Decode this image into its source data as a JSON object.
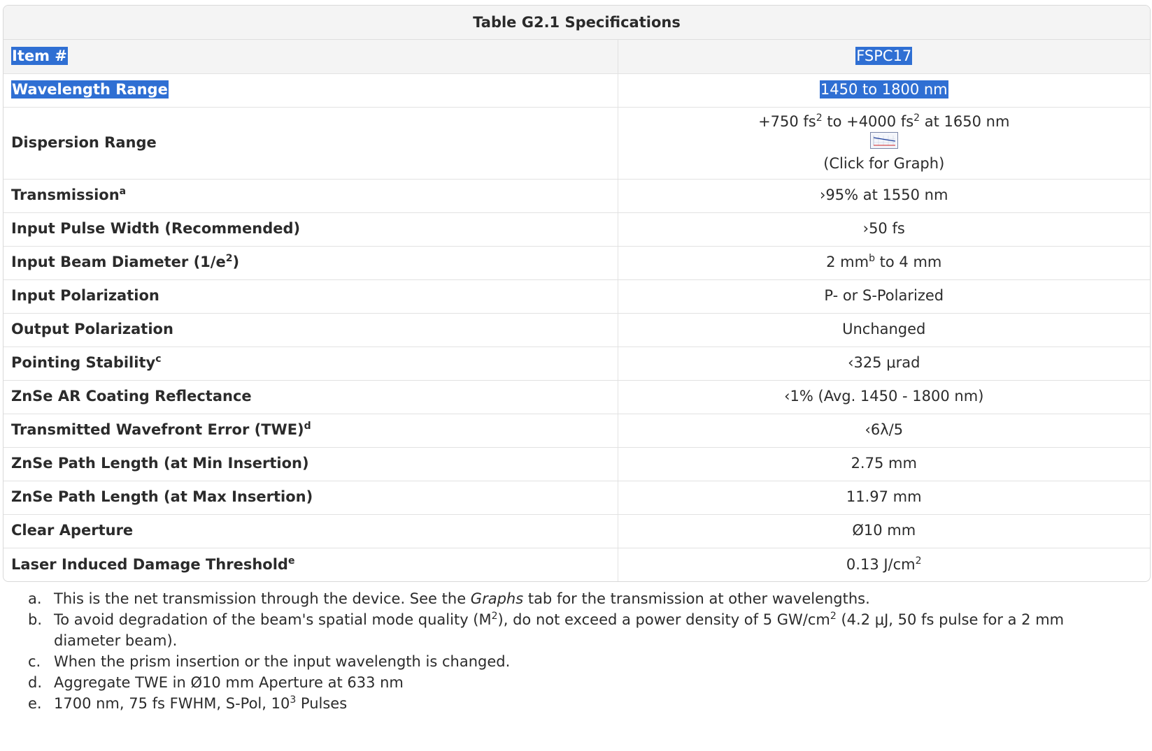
{
  "table": {
    "caption": "Table G2.1  Specifications",
    "header": {
      "label": "Item #",
      "value": "FSPC17"
    },
    "rows": [
      {
        "label": "Wavelength Range",
        "value": "1450 to 1800 nm"
      },
      {
        "label": "Dispersion Range",
        "value_a": "+750 fs",
        "value_a_sup": "2",
        "value_b": " to +4000 fs",
        "value_b_sup": "2",
        "value_c": " at 1650 nm",
        "link": "(Click for Graph)",
        "icon": "dispersion-graph-thumbnail"
      },
      {
        "label": "Transmission",
        "label_sup": "a",
        "value": "›95% at 1550 nm"
      },
      {
        "label": "Input Pulse Width (Recommended)",
        "value": "›50 fs"
      },
      {
        "label": "Input Beam Diameter (1/e",
        "label_sup": "2",
        "label_tail": ")",
        "value_a": "2 mm",
        "value_sup": "b",
        "value_b": " to 4 mm"
      },
      {
        "label": "Input Polarization",
        "value": "P- or S-Polarized"
      },
      {
        "label": "Output Polarization",
        "value": "Unchanged"
      },
      {
        "label": "Pointing Stability",
        "label_sup": "c",
        "value": "‹325 μrad"
      },
      {
        "label": "ZnSe AR Coating Reflectance",
        "value": "‹1% (Avg. 1450 - 1800 nm)"
      },
      {
        "label": "Transmitted Wavefront Error (TWE)",
        "label_sup": "d",
        "value": "‹6λ/5"
      },
      {
        "label": "ZnSe Path Length (at Min Insertion)",
        "value": "2.75 mm"
      },
      {
        "label": "ZnSe Path Length (at Max Insertion)",
        "value": "11.97 mm"
      },
      {
        "label": "Clear Aperture",
        "value": "Ø10 mm"
      },
      {
        "label": "Laser Induced Damage Threshold",
        "label_sup": "e",
        "value": "0.13 J/cm",
        "value_sup": "2"
      }
    ]
  },
  "notes": [
    {
      "letter": "a.",
      "text_a": "This is the net transmission through the device. See the ",
      "em": "Graphs",
      "text_b": " tab for the transmission at other wavelengths."
    },
    {
      "letter": "b.",
      "text_a": "To avoid degradation of the beam's spatial mode quality (M",
      "sup1": "2",
      "text_b": "), do not exceed a power density of 5 GW/cm",
      "sup2": "2",
      "text_c": " (4.2 μJ, 50 fs pulse for a 2 mm diameter beam)."
    },
    {
      "letter": "c.",
      "text": "When the prism insertion or the input wavelength is changed."
    },
    {
      "letter": "d.",
      "text": "Aggregate TWE in Ø10 mm Aperture at 633 nm"
    },
    {
      "letter": "e.",
      "text_a": "1700 nm, 75 fs FWHM, S-Pol, 10",
      "sup": "3",
      "text_b": " Pulses"
    }
  ],
  "colors": {
    "highlight": "#2f6fd3",
    "header_bg": "#f4f4f4",
    "border": "#e2e2e2"
  }
}
